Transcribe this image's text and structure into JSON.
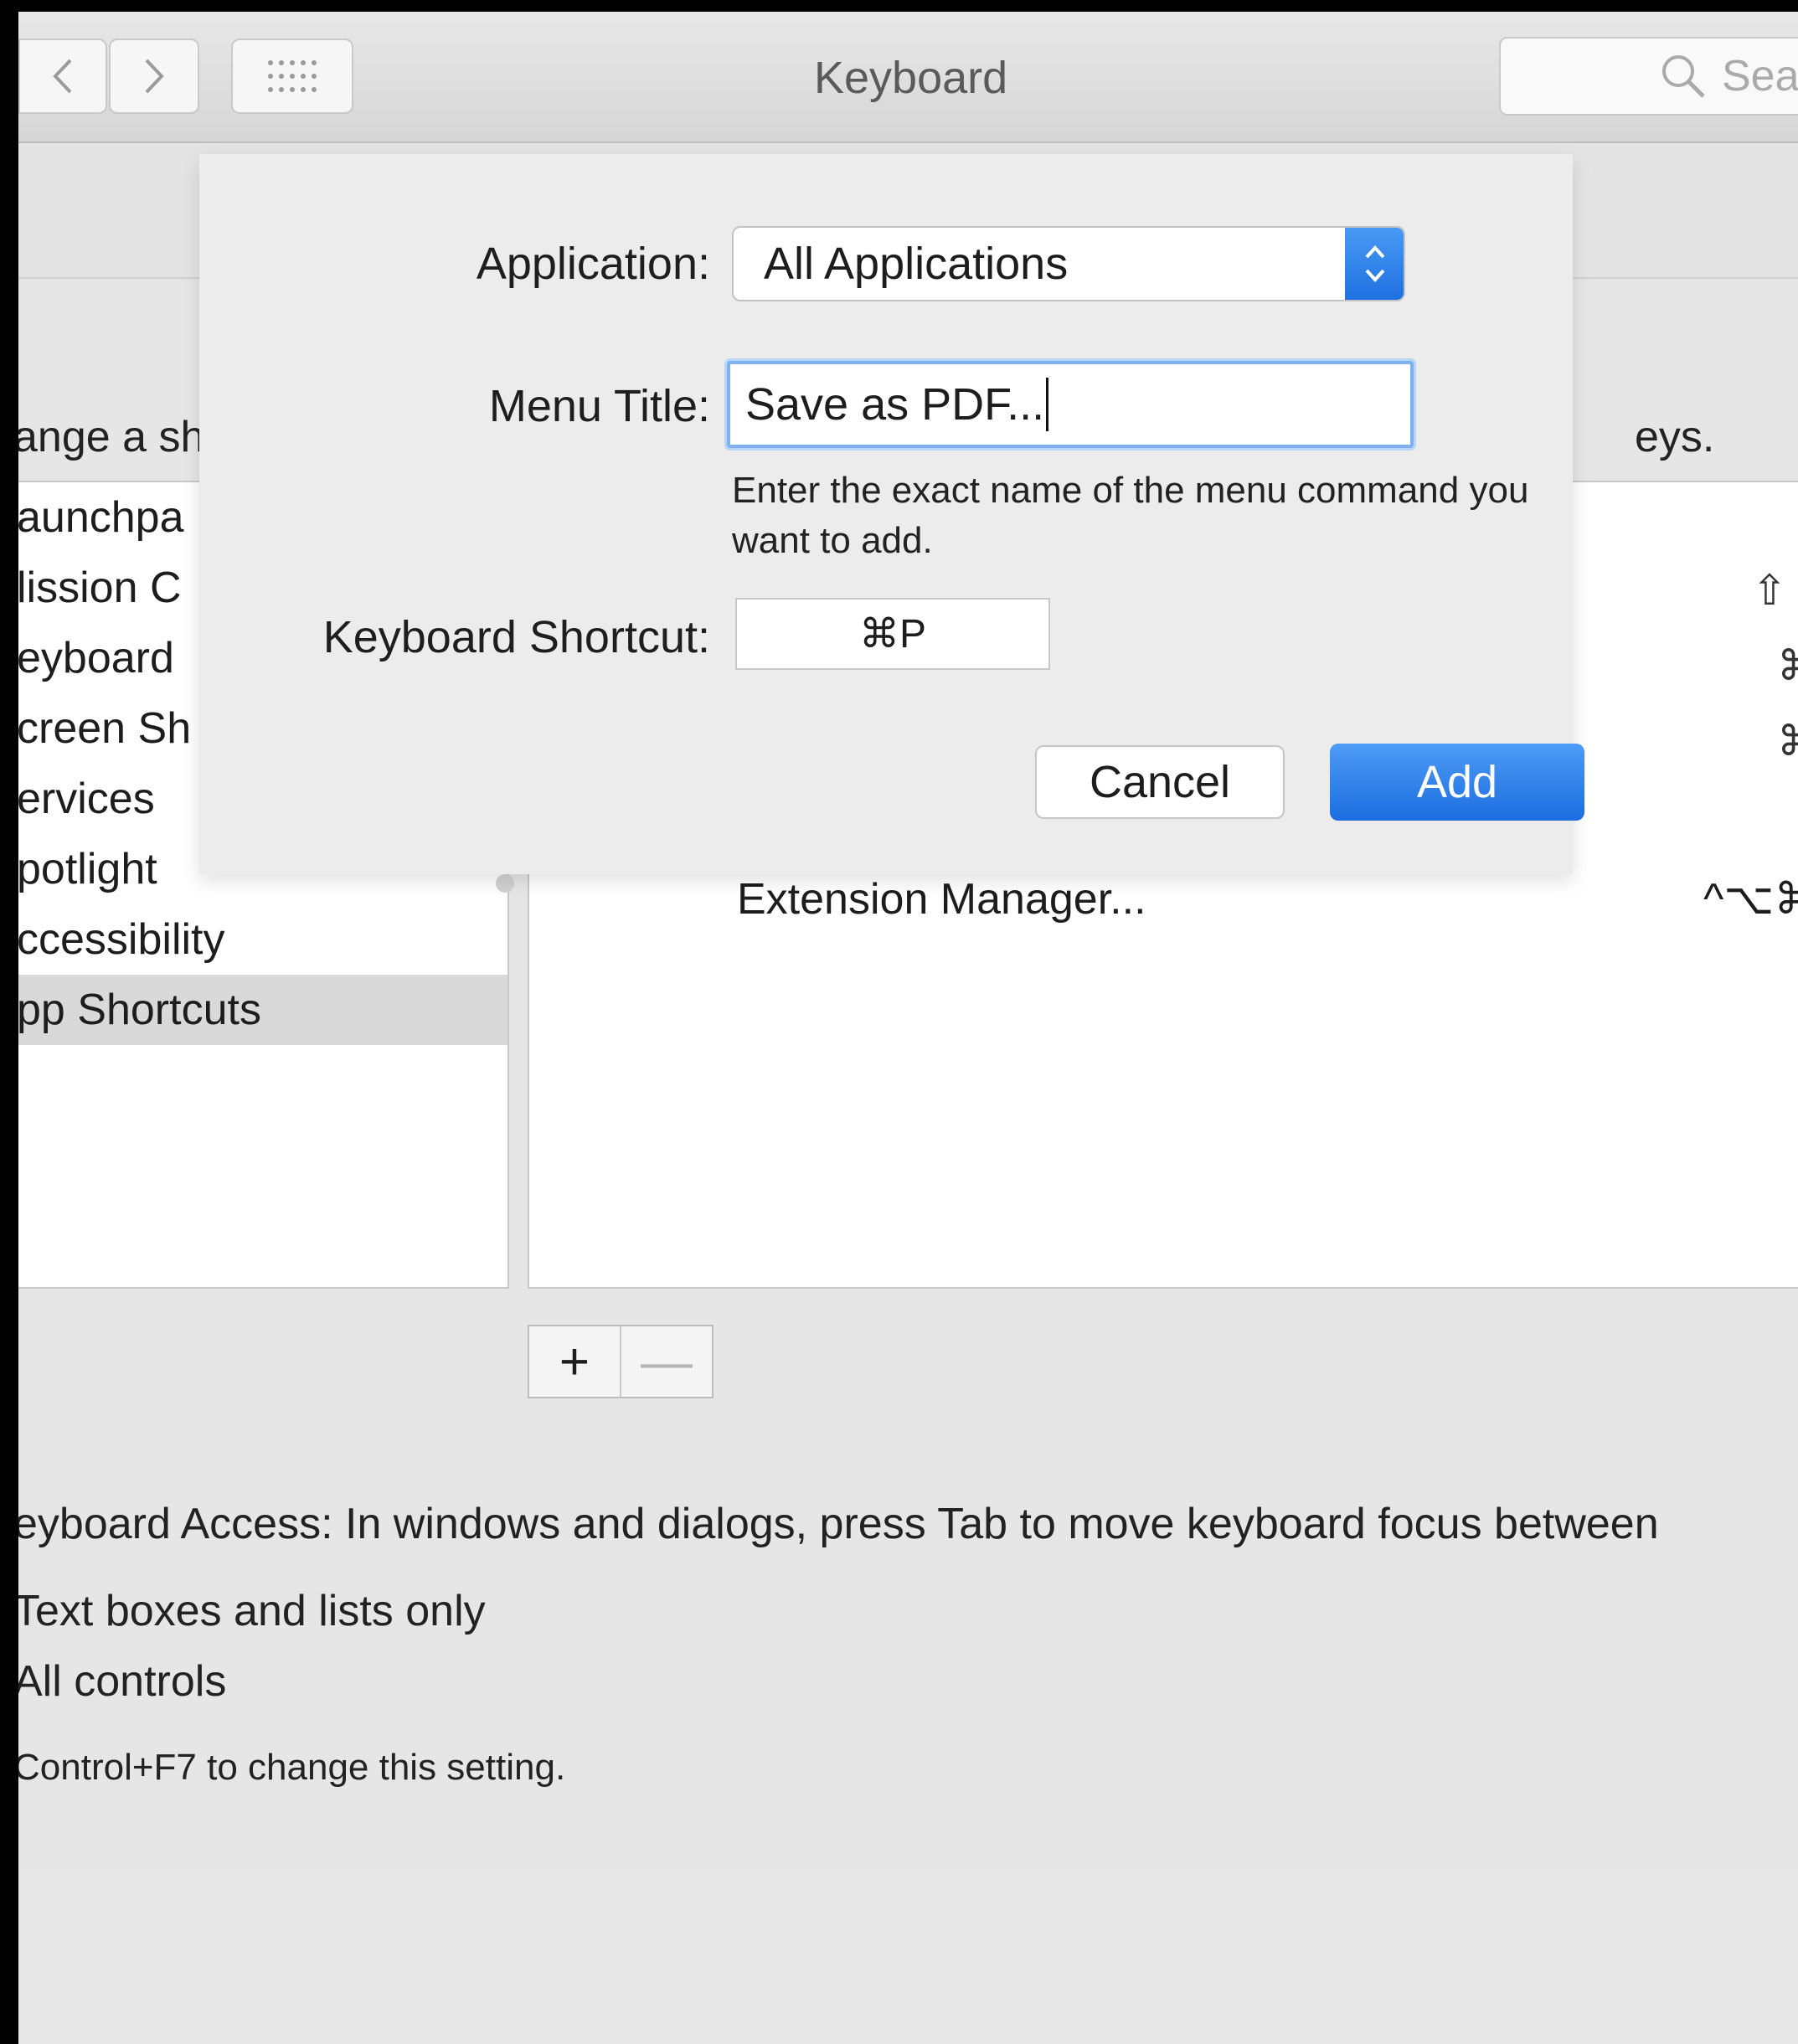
{
  "window": {
    "title": "Keyboard",
    "search_placeholder": "Sear"
  },
  "pane": {
    "description_left": "ange a sh",
    "description_right": "eys.",
    "categories": [
      {
        "label": "aunchpa",
        "selected": false
      },
      {
        "label": "lission C",
        "selected": false
      },
      {
        "label": "eyboard",
        "selected": false
      },
      {
        "label": "creen Sh",
        "selected": false
      },
      {
        "label": "ervices",
        "selected": false
      },
      {
        "label": "potlight",
        "selected": false
      },
      {
        "label": "ccessibility",
        "selected": false
      },
      {
        "label": "pp Shortcuts",
        "selected": true
      }
    ],
    "shortcut_rows": [
      {
        "name": "Extension Manager...",
        "keys": "^⌥⌘"
      }
    ],
    "right_symbols": [
      "⇧",
      "⌘",
      "⌘"
    ],
    "add_button": "+",
    "remove_button": "—",
    "keyboard_access": "eyboard Access: In windows and dialogs, press Tab to move keyboard focus between",
    "option_text_boxes": "Text boxes and lists only",
    "option_all_controls": "All controls",
    "control_hint": "Control+F7 to change this setting."
  },
  "sheet": {
    "application_label": "Application:",
    "application_value": "All Applications",
    "menu_title_label": "Menu Title:",
    "menu_title_value": "Save as PDF...",
    "hint": "Enter the exact name of the menu command you want to add.",
    "shortcut_label": "Keyboard Shortcut:",
    "shortcut_value": "⌘P",
    "cancel": "Cancel",
    "add": "Add"
  },
  "colors": {
    "accent": "#1e6fe0",
    "focus_ring": "#7fb0f1"
  }
}
